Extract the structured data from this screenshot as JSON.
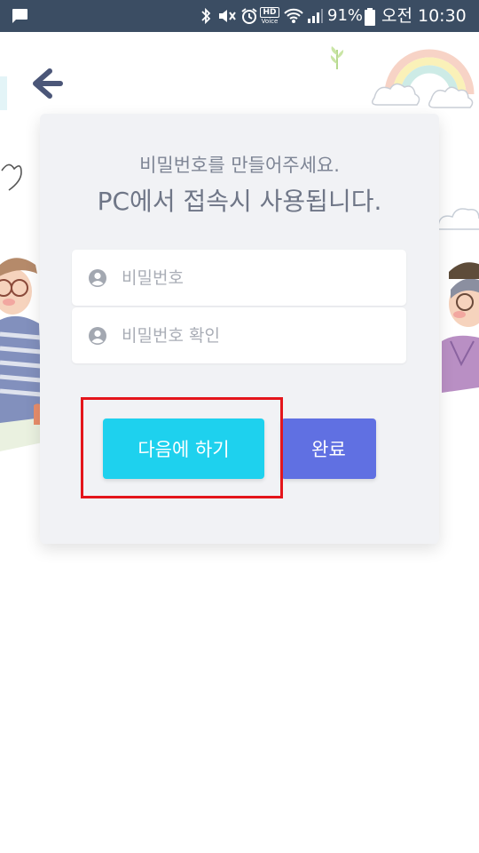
{
  "status_bar": {
    "battery_percent": "91%",
    "time": "오전 10:30",
    "hd_label": "HD",
    "voice_label": "Voice"
  },
  "card": {
    "subtitle": "비밀번호를 만들어주세요.",
    "title": "PC에서 접속시 사용됩니다.",
    "password_placeholder": "비밀번호",
    "password_confirm_placeholder": "비밀번호 확인",
    "later_button": "다음에 하기",
    "done_button": "완료"
  },
  "colors": {
    "status_bar": "#3b4d63",
    "later_button": "#1ed1ee",
    "done_button": "#6070e2",
    "highlight": "#e4151b"
  }
}
